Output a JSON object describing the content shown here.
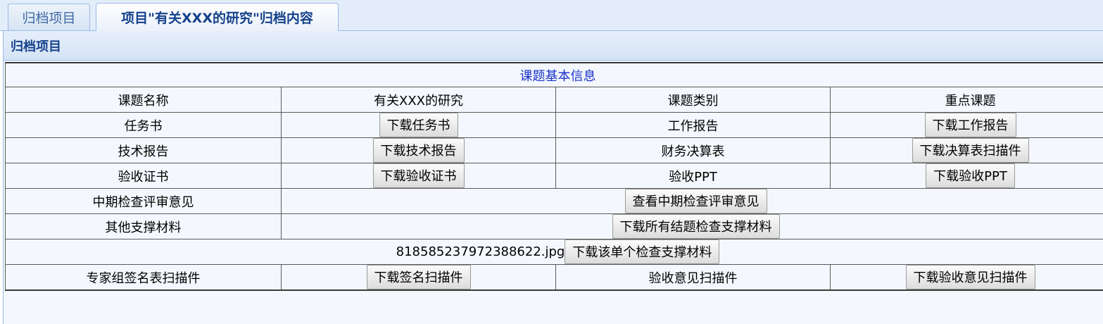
{
  "tabs": [
    {
      "label": "归档项目"
    },
    {
      "label": "项目\"有关XXX的研究\"归档内容"
    }
  ],
  "panel": {
    "title": "归档项目"
  },
  "table": {
    "heading": "课题基本信息",
    "rows": {
      "r1": {
        "c1": "课题名称",
        "c2": "有关XXX的研究",
        "c3": "课题类别",
        "c4": "重点课题"
      },
      "r2": {
        "c1": "任务书",
        "b1": "下载任务书",
        "c3": "工作报告",
        "b2": "下载工作报告"
      },
      "r3": {
        "c1": "技术报告",
        "b1": "下载技术报告",
        "c3": "财务决算表",
        "b2": "下载决算表扫描件"
      },
      "r4": {
        "c1": "验收证书",
        "b1": "下载验收证书",
        "c3": "验收PPT",
        "b2": "下载验收PPT"
      },
      "r5": {
        "c1": "中期检查评审意见",
        "b1": "查看中期检查评审意见"
      },
      "r6": {
        "c1": "其他支撑材料",
        "b1": "下载所有结题检查支撑材料"
      },
      "r7": {
        "file": "818585237972388622.jpg",
        "b1": "下载该单个检查支撑材料"
      },
      "r8": {
        "c1": "专家组签名表扫描件",
        "b1": "下载签名扫描件",
        "c3": "验收意见扫描件",
        "b2": "下载验收意见扫描件"
      }
    }
  }
}
